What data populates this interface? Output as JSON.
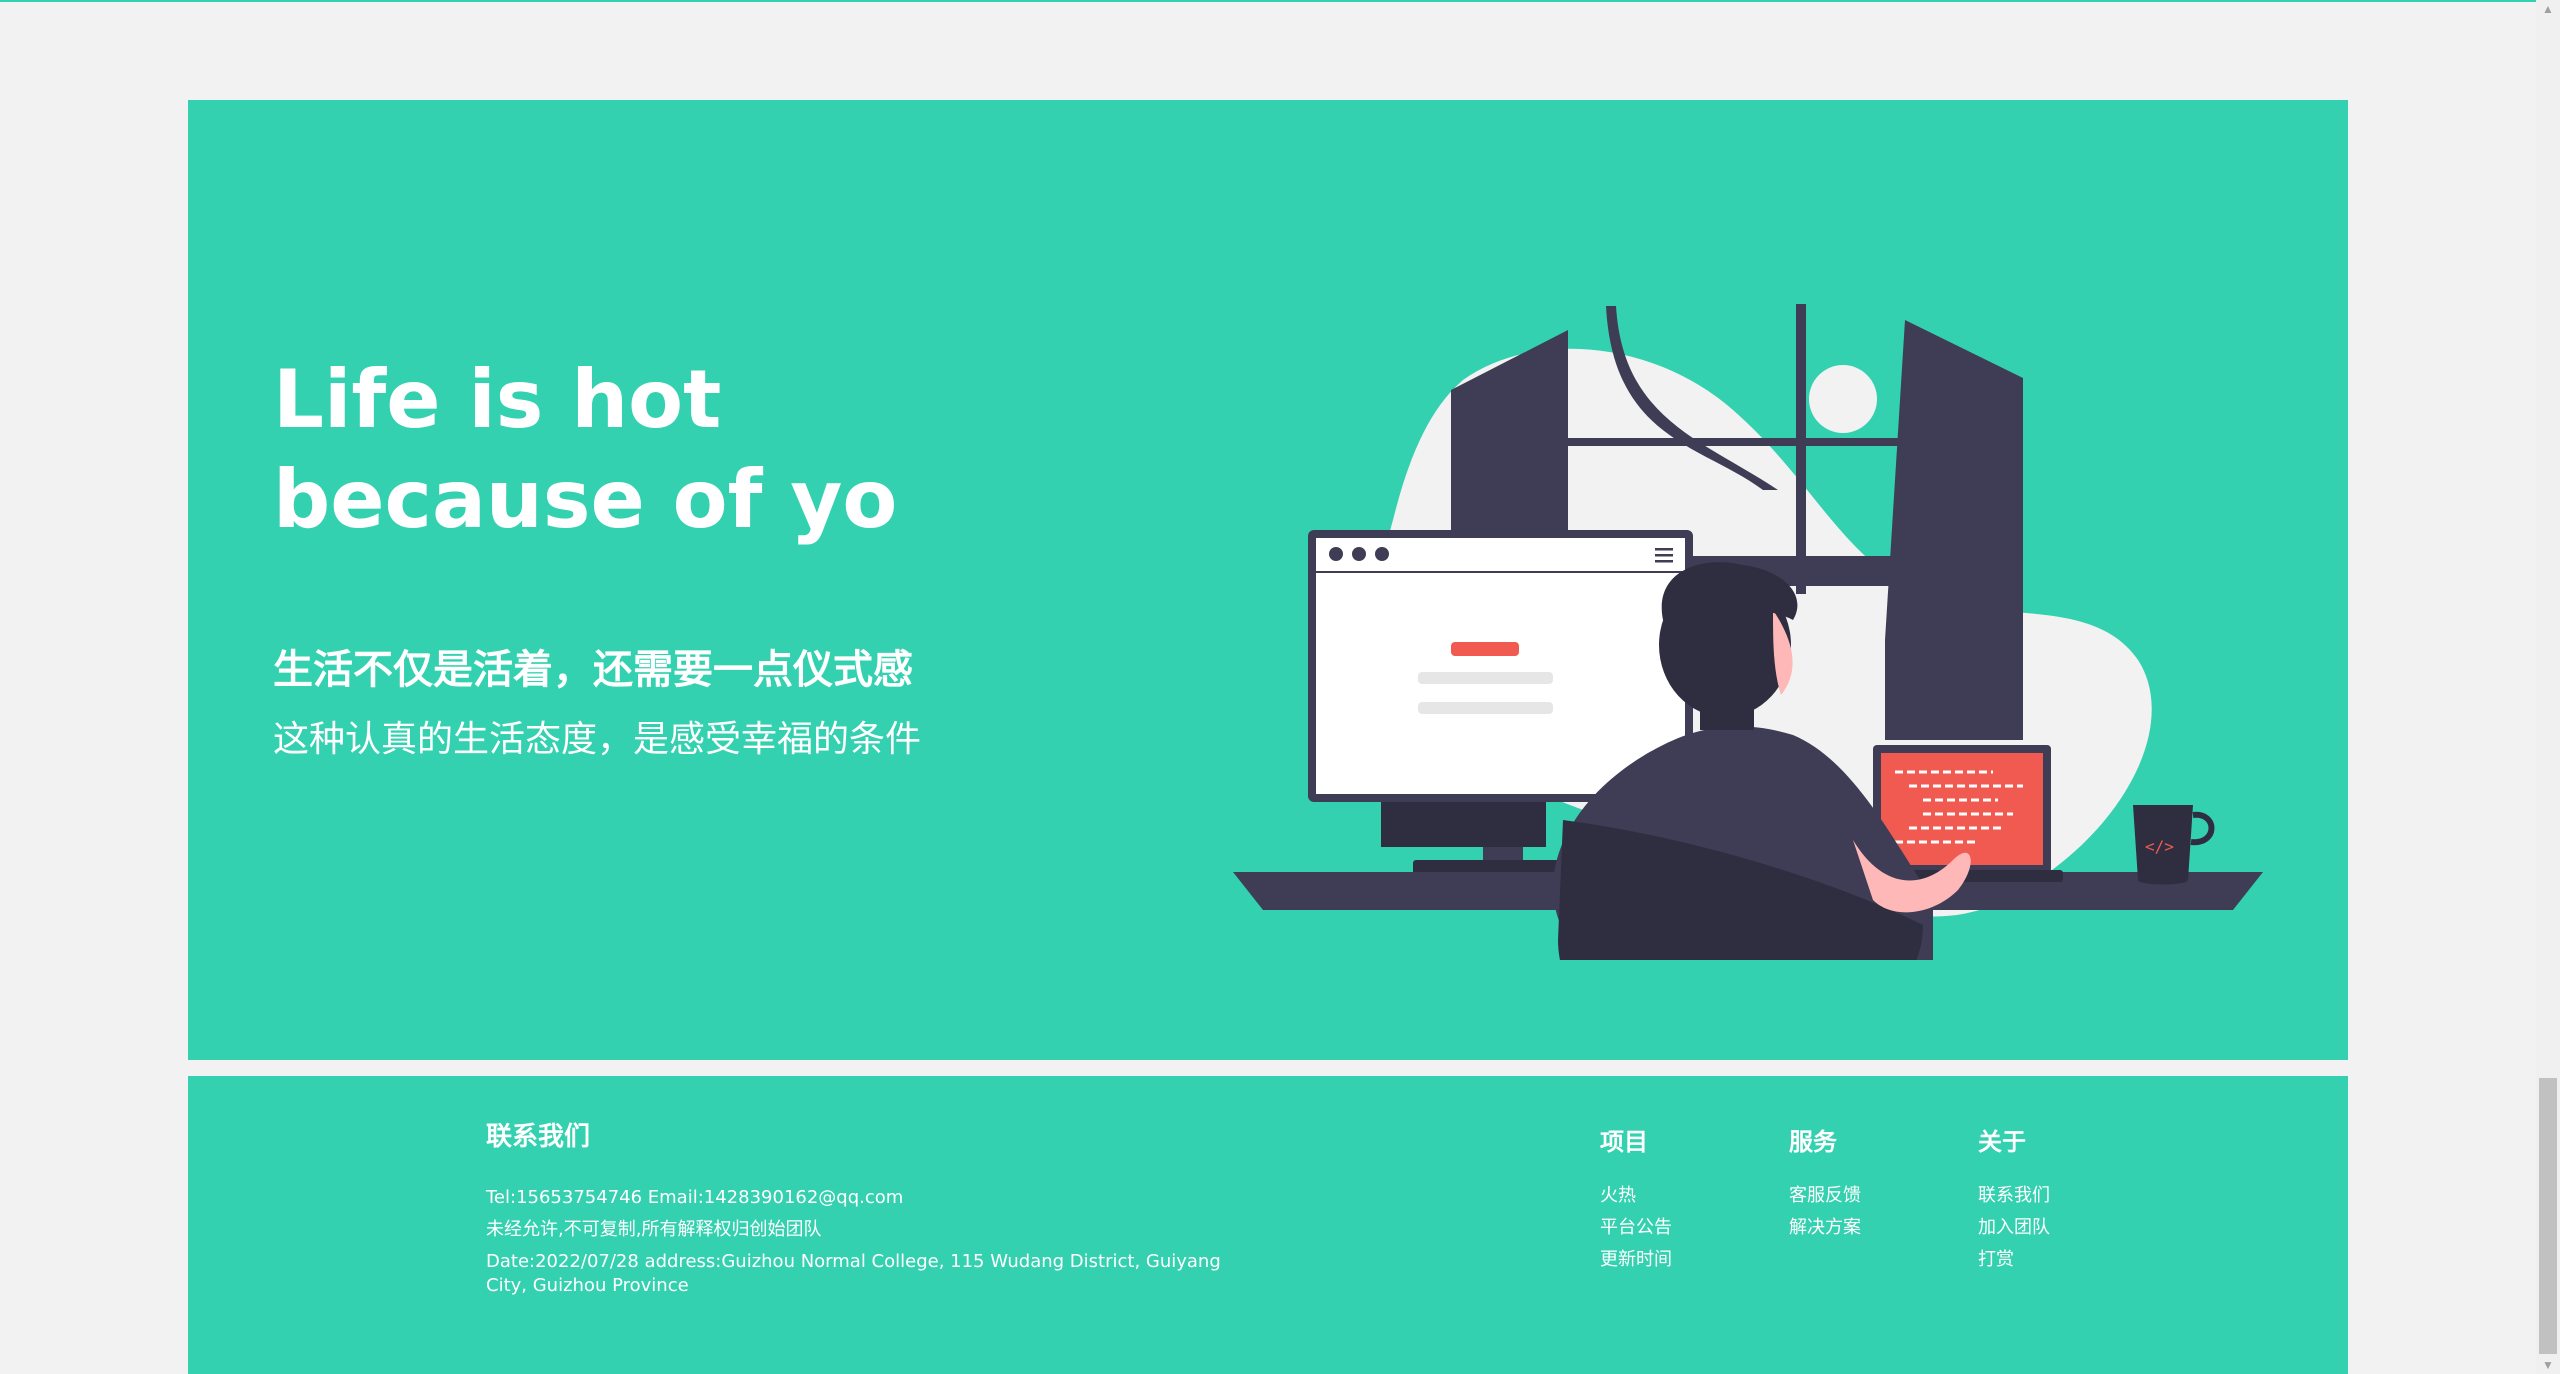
{
  "hero": {
    "title": "Life is hot because of yo",
    "subtitle": "生活不仅是活着，还需要一点仪式感",
    "text": "这种认真的生活态度，是感受幸福的条件"
  },
  "footer": {
    "contact": {
      "title": "联系我们",
      "line1": "Tel:15653754746 Email:1428390162@qq.com",
      "line2": "未经允许,不可复制,所有解释权归创始团队",
      "line3": "Date:2022/07/28 address:Guizhou Normal College, 115 Wudang District, Guiyang City, Guizhou Province"
    },
    "columns": [
      {
        "title": "项目",
        "links": [
          "火热",
          "平台公告",
          "更新时间"
        ]
      },
      {
        "title": "服务",
        "links": [
          "客服反馈",
          "解决方案"
        ]
      },
      {
        "title": "关于",
        "links": [
          "联系我们",
          "加入团队",
          "打赏"
        ]
      }
    ]
  },
  "colors": {
    "accent": "#34d1b0",
    "background": "#f2f2f2",
    "dark": "#3f3d56",
    "red": "#f05a50"
  },
  "illustration": {
    "laptop_icon": "code-icon"
  }
}
